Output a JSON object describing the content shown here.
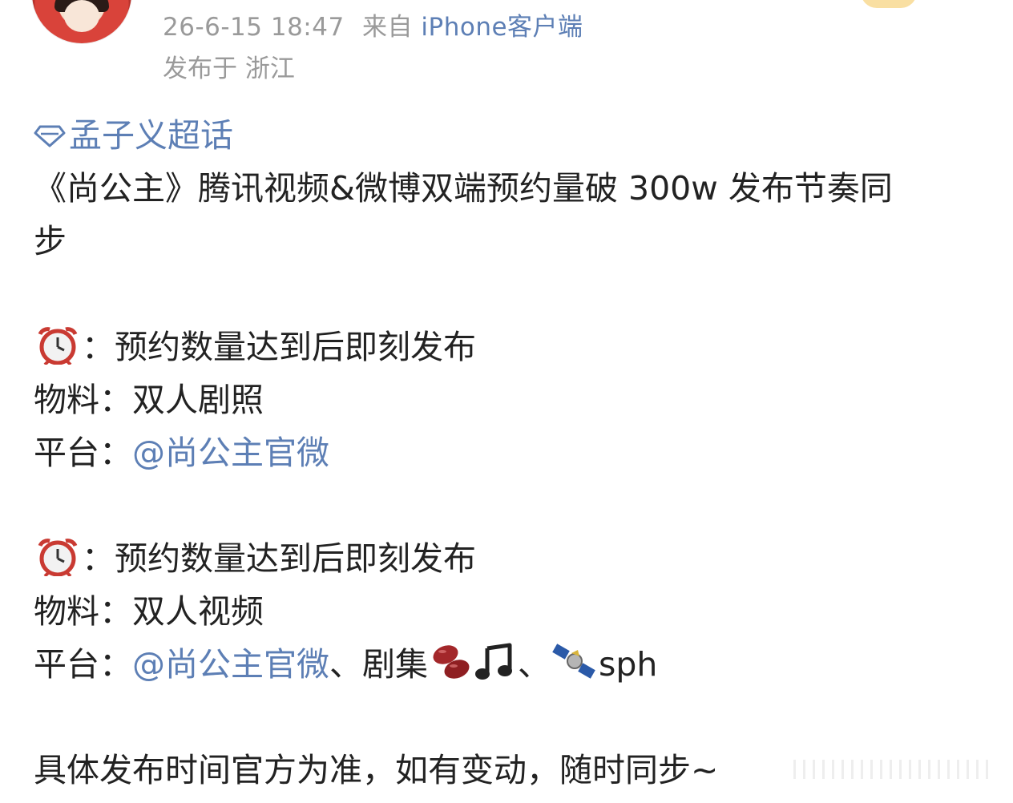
{
  "post": {
    "timestamp": "26-6-15 18:47",
    "source_prefix": "来自",
    "source_client": "iPhone客户端",
    "location": "发布于 浙江"
  },
  "content": {
    "supertopic": "孟子义超话",
    "headline_part1": "《尚公主》腾讯视频&微博双端预约量破 300w 发布节奏同",
    "headline_part2": "步",
    "block1": {
      "time_emoji": "alarm-clock",
      "time_text": "：预约数量达到后即刻发布",
      "material_label": "物料：",
      "material_value": "双人剧照",
      "platform_label": "平台：",
      "platform_link": "@尚公主官微"
    },
    "block2": {
      "time_emoji": "alarm-clock",
      "time_text": "：预约数量达到后即刻发布",
      "material_label": "物料：",
      "material_value": "双人视频",
      "platform_label": "平台：",
      "platform_link": "@尚公主官微",
      "platform_rest": "、剧集",
      "separator": "、",
      "sph": "sph"
    },
    "footer": "具体发布时间官方为准，如有变动，随时同步~"
  }
}
